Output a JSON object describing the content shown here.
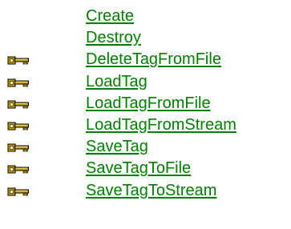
{
  "methods": [
    {
      "label": "Create",
      "icon": null
    },
    {
      "label": "Destroy",
      "icon": null
    },
    {
      "label": "DeleteTagFromFile",
      "icon": "key-icon"
    },
    {
      "label": "LoadTag",
      "icon": "key-icon"
    },
    {
      "label": "LoadTagFromFile",
      "icon": "key-icon"
    },
    {
      "label": "LoadTagFromStream",
      "icon": "key-icon"
    },
    {
      "label": "SaveTag",
      "icon": "key-icon"
    },
    {
      "label": "SaveTagToFile",
      "icon": "key-icon"
    },
    {
      "label": "SaveTagToStream",
      "icon": "key-icon"
    }
  ],
  "colors": {
    "link": "#008000",
    "key_gold": "#c8a000",
    "key_outline": "#000000",
    "background": "#ffffff"
  }
}
